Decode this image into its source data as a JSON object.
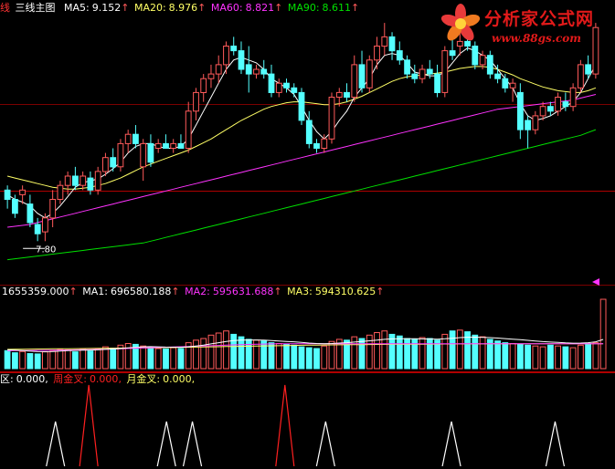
{
  "colors": {
    "up": "#ff5a5a",
    "down": "#54ffff",
    "ma5": "#ffffff",
    "ma20": "#ffff66",
    "ma60": "#ff33ff",
    "ma90": "#00e000",
    "price_label": "#ffffff",
    "ma1": "#ffffff",
    "ma2": "#ff33ff",
    "ma3": "#ffff66",
    "signal_day": "#ffffff",
    "signal_week": "#ff2020",
    "signal_month": "#ffff66",
    "separator": "#b00000",
    "grid": "#7a0000"
  },
  "main_panel": {
    "indicator": "三线主图",
    "edge_glyph": "线",
    "ma5_label": "MA5:",
    "ma5_value": "9.152",
    "ma20_label": "MA20:",
    "ma20_value": "8.976",
    "ma60_label": "MA60:",
    "ma60_value": "8.821",
    "ma90_label": "MA90:",
    "ma90_value": "8.611",
    "arrow": "↑",
    "low_marker": "7.80"
  },
  "volume_panel": {
    "volume": "1655359.000",
    "ma1_label": "MA1:",
    "ma1_value": "696580.188",
    "ma2_label": "MA2:",
    "ma2_value": "595631.688",
    "ma3_label": "MA3:",
    "ma3_value": "594310.625",
    "arrow": "↑"
  },
  "signal_panel": {
    "day_label": "区:",
    "day_value": "0.000",
    "week_label": "周金叉:",
    "week_value": "0.000",
    "month_label": "月金叉:",
    "month_value": "0.000"
  },
  "logo": {
    "title": "分析家公式网",
    "url": "www.88gs.com"
  },
  "chart_data": [
    {
      "type": "candlestick",
      "y_range": [
        7.4,
        10.2
      ],
      "x_range": [
        0,
        82
      ],
      "candles": [
        {
          "o": 8.35,
          "h": 8.4,
          "l": 8.15,
          "c": 8.25
        },
        {
          "o": 8.25,
          "h": 8.3,
          "l": 8.05,
          "c": 8.1
        },
        {
          "o": 8.3,
          "h": 8.4,
          "l": 8.2,
          "c": 8.35
        },
        {
          "o": 8.2,
          "h": 8.3,
          "l": 7.95,
          "c": 8.0
        },
        {
          "o": 7.98,
          "h": 8.05,
          "l": 7.8,
          "c": 7.88
        },
        {
          "o": 7.9,
          "h": 8.1,
          "l": 7.8,
          "c": 8.05
        },
        {
          "o": 8.05,
          "h": 8.35,
          "l": 7.95,
          "c": 8.25
        },
        {
          "o": 8.25,
          "h": 8.45,
          "l": 8.2,
          "c": 8.4
        },
        {
          "o": 8.4,
          "h": 8.55,
          "l": 8.3,
          "c": 8.5
        },
        {
          "o": 8.5,
          "h": 8.6,
          "l": 8.35,
          "c": 8.4
        },
        {
          "o": 8.4,
          "h": 8.55,
          "l": 8.35,
          "c": 8.5
        },
        {
          "o": 8.48,
          "h": 8.55,
          "l": 8.3,
          "c": 8.35
        },
        {
          "o": 8.35,
          "h": 8.6,
          "l": 8.3,
          "c": 8.55
        },
        {
          "o": 8.55,
          "h": 8.75,
          "l": 8.5,
          "c": 8.7
        },
        {
          "o": 8.7,
          "h": 8.8,
          "l": 8.55,
          "c": 8.6
        },
        {
          "o": 8.6,
          "h": 8.9,
          "l": 8.55,
          "c": 8.85
        },
        {
          "o": 8.85,
          "h": 9.0,
          "l": 8.75,
          "c": 8.95
        },
        {
          "o": 8.95,
          "h": 9.05,
          "l": 8.8,
          "c": 8.85
        },
        {
          "o": 8.6,
          "h": 8.9,
          "l": 8.45,
          "c": 8.85
        },
        {
          "o": 8.85,
          "h": 8.95,
          "l": 8.6,
          "c": 8.65
        },
        {
          "o": 8.8,
          "h": 8.9,
          "l": 8.75,
          "c": 8.85
        },
        {
          "o": 8.85,
          "h": 8.95,
          "l": 8.8,
          "c": 8.8
        },
        {
          "o": 8.8,
          "h": 8.9,
          "l": 8.75,
          "c": 8.85
        },
        {
          "o": 8.85,
          "h": 8.95,
          "l": 8.8,
          "c": 8.8
        },
        {
          "o": 8.8,
          "h": 9.3,
          "l": 8.75,
          "c": 9.2
        },
        {
          "o": 9.2,
          "h": 9.45,
          "l": 9.1,
          "c": 9.4
        },
        {
          "o": 9.4,
          "h": 9.6,
          "l": 9.3,
          "c": 9.55
        },
        {
          "o": 9.55,
          "h": 9.7,
          "l": 9.45,
          "c": 9.6
        },
        {
          "o": 9.6,
          "h": 9.8,
          "l": 9.5,
          "c": 9.7
        },
        {
          "o": 9.7,
          "h": 9.95,
          "l": 9.6,
          "c": 9.9
        },
        {
          "o": 9.9,
          "h": 10.0,
          "l": 9.8,
          "c": 9.85
        },
        {
          "o": 9.85,
          "h": 9.95,
          "l": 9.6,
          "c": 9.65
        },
        {
          "o": 9.7,
          "h": 9.9,
          "l": 9.4,
          "c": 9.6
        },
        {
          "o": 9.6,
          "h": 9.7,
          "l": 9.55,
          "c": 9.65
        },
        {
          "o": 9.65,
          "h": 9.75,
          "l": 9.55,
          "c": 9.6
        },
        {
          "o": 9.6,
          "h": 9.7,
          "l": 9.35,
          "c": 9.4
        },
        {
          "o": 9.4,
          "h": 9.55,
          "l": 9.35,
          "c": 9.5
        },
        {
          "o": 9.5,
          "h": 9.55,
          "l": 9.4,
          "c": 9.45
        },
        {
          "o": 9.45,
          "h": 9.5,
          "l": 9.35,
          "c": 9.4
        },
        {
          "o": 9.4,
          "h": 9.45,
          "l": 9.05,
          "c": 9.1
        },
        {
          "o": 9.1,
          "h": 9.2,
          "l": 8.8,
          "c": 8.85
        },
        {
          "o": 8.85,
          "h": 8.9,
          "l": 8.75,
          "c": 8.8
        },
        {
          "o": 8.8,
          "h": 8.95,
          "l": 8.75,
          "c": 8.9
        },
        {
          "o": 8.9,
          "h": 9.4,
          "l": 8.85,
          "c": 9.35
        },
        {
          "o": 9.35,
          "h": 9.45,
          "l": 9.25,
          "c": 9.4
        },
        {
          "o": 9.4,
          "h": 9.5,
          "l": 9.3,
          "c": 9.35
        },
        {
          "o": 9.35,
          "h": 9.8,
          "l": 9.3,
          "c": 9.7
        },
        {
          "o": 9.7,
          "h": 9.85,
          "l": 9.4,
          "c": 9.45
        },
        {
          "o": 9.45,
          "h": 9.8,
          "l": 9.4,
          "c": 9.75
        },
        {
          "o": 9.75,
          "h": 10.0,
          "l": 9.65,
          "c": 9.9
        },
        {
          "o": 9.9,
          "h": 10.15,
          "l": 9.8,
          "c": 10.0
        },
        {
          "o": 10.0,
          "h": 10.05,
          "l": 9.75,
          "c": 9.85
        },
        {
          "o": 9.85,
          "h": 9.95,
          "l": 9.7,
          "c": 9.75
        },
        {
          "o": 9.75,
          "h": 9.8,
          "l": 9.55,
          "c": 9.6
        },
        {
          "o": 9.6,
          "h": 9.7,
          "l": 9.5,
          "c": 9.55
        },
        {
          "o": 9.55,
          "h": 9.7,
          "l": 9.5,
          "c": 9.65
        },
        {
          "o": 9.65,
          "h": 9.75,
          "l": 9.55,
          "c": 9.6
        },
        {
          "o": 9.6,
          "h": 9.7,
          "l": 9.35,
          "c": 9.4
        },
        {
          "o": 9.4,
          "h": 9.9,
          "l": 9.35,
          "c": 9.85
        },
        {
          "o": 9.85,
          "h": 10.0,
          "l": 9.75,
          "c": 9.8
        },
        {
          "o": 9.9,
          "h": 10.05,
          "l": 9.8,
          "c": 9.95
        },
        {
          "o": 9.95,
          "h": 10.1,
          "l": 9.85,
          "c": 9.9
        },
        {
          "o": 9.9,
          "h": 9.95,
          "l": 9.65,
          "c": 9.7
        },
        {
          "o": 9.7,
          "h": 9.85,
          "l": 9.65,
          "c": 9.8
        },
        {
          "o": 9.8,
          "h": 9.85,
          "l": 9.55,
          "c": 9.6
        },
        {
          "o": 9.6,
          "h": 9.7,
          "l": 9.5,
          "c": 9.55
        },
        {
          "o": 9.55,
          "h": 9.6,
          "l": 9.4,
          "c": 9.45
        },
        {
          "o": 9.45,
          "h": 9.55,
          "l": 9.3,
          "c": 9.5
        },
        {
          "o": 9.4,
          "h": 9.5,
          "l": 8.9,
          "c": 9.0
        },
        {
          "o": 9.1,
          "h": 9.15,
          "l": 8.8,
          "c": 9.0
        },
        {
          "o": 9.0,
          "h": 9.2,
          "l": 8.95,
          "c": 9.15
        },
        {
          "o": 9.15,
          "h": 9.3,
          "l": 9.1,
          "c": 9.25
        },
        {
          "o": 9.25,
          "h": 9.3,
          "l": 9.15,
          "c": 9.2
        },
        {
          "o": 9.2,
          "h": 9.4,
          "l": 9.15,
          "c": 9.35
        },
        {
          "o": 9.3,
          "h": 9.4,
          "l": 9.2,
          "c": 9.25
        },
        {
          "o": 9.25,
          "h": 9.5,
          "l": 9.2,
          "c": 9.45
        },
        {
          "o": 9.45,
          "h": 9.75,
          "l": 9.4,
          "c": 9.7
        },
        {
          "o": 9.7,
          "h": 9.8,
          "l": 9.55,
          "c": 9.6
        },
        {
          "o": 9.6,
          "h": 10.15,
          "l": 9.55,
          "c": 10.1
        }
      ],
      "ma5": [
        8.3,
        8.25,
        8.22,
        8.18,
        8.1,
        8.05,
        8.1,
        8.18,
        8.28,
        8.38,
        8.43,
        8.45,
        8.47,
        8.52,
        8.58,
        8.65,
        8.75,
        8.82,
        8.85,
        8.85,
        8.82,
        8.8,
        8.8,
        8.82,
        8.9,
        9.05,
        9.2,
        9.35,
        9.5,
        9.65,
        9.75,
        9.78,
        9.75,
        9.72,
        9.65,
        9.55,
        9.5,
        9.45,
        9.38,
        9.25,
        9.1,
        8.98,
        8.9,
        8.98,
        9.1,
        9.2,
        9.35,
        9.45,
        9.55,
        9.7,
        9.8,
        9.82,
        9.8,
        9.72,
        9.62,
        9.6,
        9.58,
        9.58,
        9.62,
        9.72,
        9.82,
        9.88,
        9.85,
        9.8,
        9.75,
        9.65,
        9.55,
        9.45,
        9.28,
        9.15,
        9.1,
        9.12,
        9.15,
        9.2,
        9.25,
        9.3,
        9.4,
        9.55,
        9.7
      ],
      "ma20": [
        8.5,
        8.48,
        8.46,
        8.44,
        8.42,
        8.4,
        8.38,
        8.37,
        8.36,
        8.36,
        8.37,
        8.38,
        8.4,
        8.42,
        8.45,
        8.48,
        8.52,
        8.56,
        8.6,
        8.63,
        8.66,
        8.69,
        8.72,
        8.75,
        8.78,
        8.82,
        8.86,
        8.9,
        8.95,
        9.0,
        9.05,
        9.1,
        9.14,
        9.18,
        9.22,
        9.25,
        9.27,
        9.29,
        9.3,
        9.3,
        9.29,
        9.28,
        9.27,
        9.27,
        9.28,
        9.3,
        9.33,
        9.36,
        9.4,
        9.44,
        9.48,
        9.52,
        9.55,
        9.57,
        9.58,
        9.59,
        9.6,
        9.61,
        9.62,
        9.64,
        9.66,
        9.67,
        9.68,
        9.68,
        9.67,
        9.65,
        9.62,
        9.59,
        9.55,
        9.52,
        9.49,
        9.46,
        9.44,
        9.42,
        9.41,
        9.4,
        9.4,
        9.42,
        9.45
      ],
      "ma60": [
        7.95,
        7.96,
        7.97,
        7.98,
        8.0,
        8.02,
        8.04,
        8.06,
        8.08,
        8.1,
        8.12,
        8.14,
        8.16,
        8.18,
        8.2,
        8.22,
        8.24,
        8.26,
        8.28,
        8.3,
        8.32,
        8.34,
        8.36,
        8.38,
        8.4,
        8.42,
        8.44,
        8.46,
        8.48,
        8.5,
        8.52,
        8.54,
        8.56,
        8.58,
        8.6,
        8.62,
        8.64,
        8.66,
        8.68,
        8.7,
        8.72,
        8.74,
        8.76,
        8.78,
        8.8,
        8.82,
        8.84,
        8.86,
        8.88,
        8.9,
        8.92,
        8.94,
        8.96,
        8.98,
        9.0,
        9.02,
        9.04,
        9.06,
        9.08,
        9.1,
        9.12,
        9.14,
        9.16,
        9.18,
        9.2,
        9.22,
        9.23,
        9.24,
        9.25,
        9.26,
        9.27,
        9.28,
        9.29,
        9.3,
        9.31,
        9.32,
        9.34,
        9.36,
        9.38
      ],
      "ma90": [
        7.6,
        7.61,
        7.62,
        7.63,
        7.64,
        7.65,
        7.66,
        7.67,
        7.68,
        7.69,
        7.7,
        7.71,
        7.72,
        7.73,
        7.74,
        7.75,
        7.76,
        7.77,
        7.78,
        7.8,
        7.82,
        7.84,
        7.86,
        7.88,
        7.9,
        7.92,
        7.94,
        7.96,
        7.98,
        8.0,
        8.02,
        8.04,
        8.06,
        8.08,
        8.1,
        8.12,
        8.14,
        8.16,
        8.18,
        8.2,
        8.22,
        8.24,
        8.26,
        8.28,
        8.3,
        8.32,
        8.34,
        8.36,
        8.38,
        8.4,
        8.42,
        8.44,
        8.46,
        8.48,
        8.5,
        8.52,
        8.54,
        8.56,
        8.58,
        8.6,
        8.62,
        8.64,
        8.66,
        8.68,
        8.7,
        8.72,
        8.74,
        8.76,
        8.78,
        8.8,
        8.82,
        8.84,
        8.86,
        8.88,
        8.9,
        8.92,
        8.94,
        8.97,
        9.0
      ]
    },
    {
      "type": "bar",
      "y_range": [
        0,
        1700000
      ],
      "volumes": [
        430000,
        380000,
        410000,
        360000,
        350000,
        400000,
        420000,
        460000,
        450000,
        400000,
        470000,
        420000,
        480000,
        520000,
        490000,
        560000,
        600000,
        580000,
        540000,
        520000,
        480000,
        470000,
        500000,
        480000,
        620000,
        680000,
        720000,
        800000,
        850000,
        900000,
        820000,
        760000,
        700000,
        680000,
        660000,
        620000,
        600000,
        580000,
        560000,
        520000,
        500000,
        480000,
        540000,
        650000,
        700000,
        680000,
        760000,
        720000,
        800000,
        860000,
        900000,
        820000,
        780000,
        720000,
        700000,
        740000,
        720000,
        680000,
        820000,
        900000,
        920000,
        880000,
        800000,
        760000,
        700000,
        660000,
        620000,
        600000,
        580000,
        560000,
        540000,
        520000,
        560000,
        540000,
        520000,
        500000,
        560000,
        600000,
        620000,
        1655359
      ],
      "ma1": [
        450000,
        440000,
        430000,
        420000,
        410000,
        405000,
        410000,
        420000,
        430000,
        435000,
        440000,
        445000,
        450000,
        460000,
        470000,
        480000,
        495000,
        510000,
        520000,
        525000,
        520000,
        515000,
        512000,
        510000,
        520000,
        540000,
        560000,
        590000,
        620000,
        650000,
        670000,
        680000,
        685000,
        685000,
        680000,
        670000,
        660000,
        650000,
        640000,
        625000,
        610000,
        600000,
        595000,
        600000,
        610000,
        620000,
        635000,
        650000,
        665000,
        680000,
        700000,
        710000,
        715000,
        715000,
        712000,
        710000,
        708000,
        705000,
        712000,
        725000,
        740000,
        750000,
        752000,
        748000,
        740000,
        730000,
        718000,
        705000,
        690000,
        675000,
        660000,
        645000,
        635000,
        625000,
        615000,
        608000,
        610000,
        620000,
        640000,
        696580
      ],
      "ma2": [
        430000,
        430000,
        432000,
        434000,
        436000,
        438000,
        440000,
        442000,
        445000,
        448000,
        452000,
        456000,
        460000,
        465000,
        470000,
        476000,
        482000,
        488000,
        494000,
        500000,
        506000,
        512000,
        518000,
        524000,
        530000,
        536000,
        542000,
        548000,
        554000,
        560000,
        566000,
        572000,
        578000,
        582000,
        586000,
        590000,
        592000,
        594000,
        595000,
        596000,
        596000,
        596000,
        596000,
        596000,
        596000,
        596000,
        596000,
        596000,
        596000,
        596000,
        596000,
        596000,
        596000,
        596000,
        596000,
        596000,
        596000,
        596000,
        596000,
        596000,
        596000,
        596000,
        596000,
        596000,
        596000,
        596000,
        596000,
        596000,
        596000,
        596000,
        596000,
        596000,
        596000,
        596000,
        596000,
        596000,
        596000,
        596000,
        596000,
        595631
      ],
      "ma3": [
        460000,
        462000,
        464000,
        466000,
        468000,
        470000,
        472000,
        474000,
        476000,
        478000,
        480000,
        482000,
        484000,
        486000,
        488000,
        490000,
        492000,
        494000,
        496000,
        498000,
        500000,
        503000,
        506000,
        509000,
        512000,
        515000,
        518000,
        521000,
        524000,
        527000,
        530000,
        533000,
        536000,
        539000,
        542000,
        545000,
        548000,
        551000,
        554000,
        557000,
        560000,
        562000,
        564000,
        566000,
        568000,
        570000,
        572000,
        574000,
        576000,
        578000,
        580000,
        581000,
        582000,
        583000,
        584000,
        585000,
        586000,
        587000,
        588000,
        589000,
        590000,
        590500,
        591000,
        591500,
        592000,
        592500,
        593000,
        593200,
        593400,
        593600,
        593800,
        594000,
        594050,
        594100,
        594150,
        594200,
        594250,
        594280,
        594300,
        594310
      ]
    },
    {
      "type": "signal",
      "series": [
        {
          "name": "周金叉",
          "x": [
            23,
            76
          ],
          "height": 1.0
        },
        {
          "name": "月金叉",
          "x": [],
          "height": 1.0
        }
      ],
      "day_signals": {
        "x": [
          14,
          44,
          51,
          87,
          121,
          149
        ],
        "height": 0.55
      }
    }
  ]
}
